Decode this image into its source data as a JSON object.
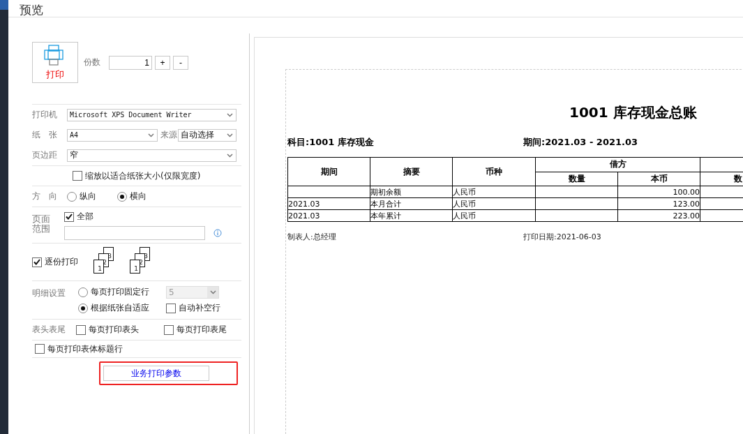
{
  "window": {
    "title": "预览"
  },
  "print_button": {
    "label": "打印"
  },
  "copies": {
    "label": "份数",
    "value": "1",
    "buttons": [
      "+",
      "-"
    ]
  },
  "printer": {
    "label": "打印机",
    "value": "Microsoft XPS Document Writer"
  },
  "paper": {
    "label": "纸　张",
    "value": "A4",
    "source_label": "来源",
    "source_value": "自动选择"
  },
  "margin": {
    "label": "页边距",
    "value": "窄"
  },
  "fit_width": {
    "label": "缩放以适合纸张大小(仅限宽度)",
    "checked": false
  },
  "orientation": {
    "label": "方　向",
    "options": [
      {
        "label": "纵向",
        "selected": false
      },
      {
        "label": "横向",
        "selected": true
      }
    ]
  },
  "page_range": {
    "label": "页面范围",
    "all": {
      "label": "全部",
      "checked": true
    }
  },
  "collate": {
    "label": "逐份打印",
    "checked": true,
    "stacks": [
      [
        "1",
        "2",
        "3"
      ],
      [
        "1",
        "2",
        "3"
      ]
    ]
  },
  "detail": {
    "label": "明细设置",
    "options": [
      {
        "label": "每页打印固定行",
        "selected": false
      },
      {
        "label": "根据纸张自适应",
        "selected": true
      }
    ],
    "rows_value": "5",
    "rows_disabled": true,
    "auto_fill": {
      "label": "自动补空行",
      "checked": false
    }
  },
  "header_footer": {
    "label": "表头表尾",
    "options": [
      {
        "label": "每页打印表头",
        "checked": false
      },
      {
        "label": "每页打印表尾",
        "checked": false
      }
    ]
  },
  "title_row": {
    "label": "每页打印表体标题行",
    "checked": false
  },
  "business_button": {
    "label": "业务打印参数",
    "highlighted": true
  },
  "preview": {
    "title": "1001 库存现金总账",
    "subject": "科目:1001 库存现金",
    "period": "期间:2021.03 - 2021.03",
    "header_top": [
      "期间",
      "摘要",
      "币种",
      "借方"
    ],
    "header_sub": [
      "数量",
      "本币",
      "数"
    ],
    "rows": [
      [
        "",
        "期初余额",
        "人民币",
        "",
        "100.00"
      ],
      [
        "2021.03",
        "本月合计",
        "人民币",
        "",
        "123.00"
      ],
      [
        "2021.03",
        "本年累计",
        "人民币",
        "",
        "223.00"
      ]
    ],
    "maker": "制表人:总经理",
    "print_date": "打印日期:2021-06-03"
  }
}
